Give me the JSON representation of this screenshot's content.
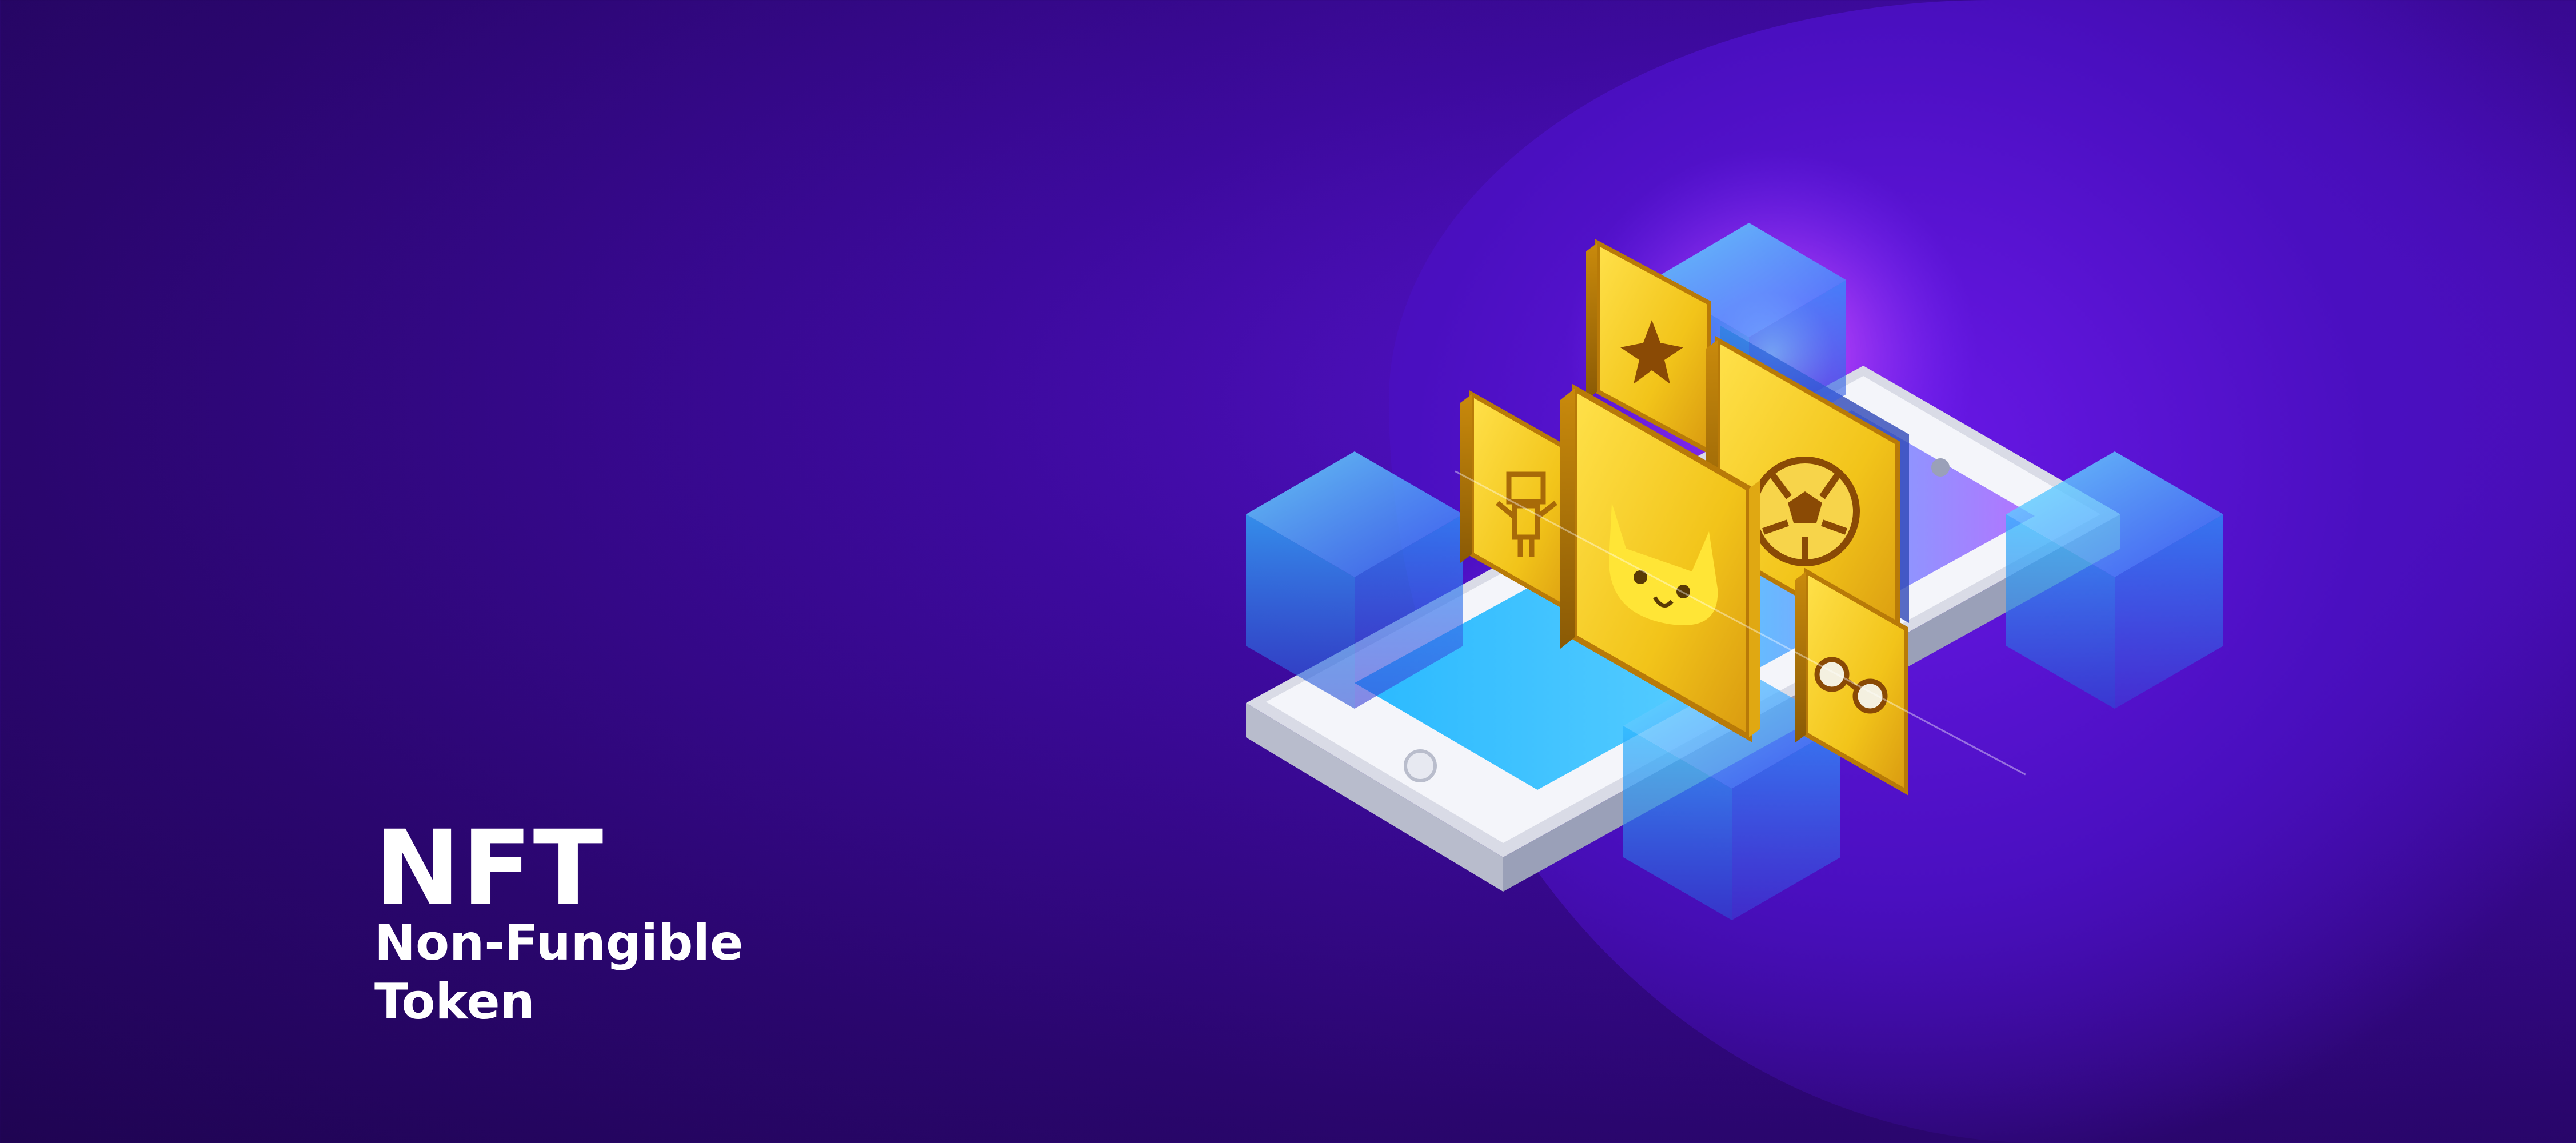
{
  "headline": {
    "title": "NFT",
    "subtitle_line1": "Non-Fungible",
    "subtitle_line2": "Token"
  },
  "colors": {
    "background_dark": "#1f0452",
    "background_mid": "#3d0a9e",
    "highlight_purple": "#6a18e8",
    "gold": "#f2c41a",
    "gold_dark": "#c98a0c",
    "cube_cyan": "#2fd6ff",
    "cube_blue": "#3b5bff",
    "text_white": "#ffffff"
  },
  "illustration": {
    "device": "smartphone-isometric",
    "cards": [
      "star-icon",
      "robot-icon",
      "cat-icon",
      "soccer-ball-icon",
      "glasses-icon"
    ],
    "cubes": 4
  }
}
